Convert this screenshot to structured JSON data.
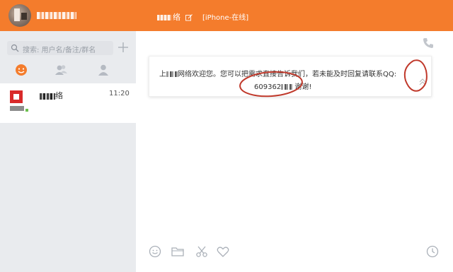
{
  "left_header": {
    "user_name": "-~~ ~~ ~~"
  },
  "search": {
    "placeholder": "搜索: 用户名/备注/群名"
  },
  "tabs": [
    {
      "icon": "smiley-icon",
      "active": true
    },
    {
      "icon": "contacts-icon",
      "active": false
    },
    {
      "icon": "person-icon",
      "active": false
    }
  ],
  "contacts": [
    {
      "name_suffix": "络",
      "time": "11:20"
    }
  ],
  "chat": {
    "title_suffix": "络",
    "status": "[iPhone-在线]",
    "message": {
      "line1_a": "上",
      "line1_b": "网络欢迎您。您可以把需求直接告诉我们，若未能及时回复请联系QQ:",
      "line2_a": "609362",
      "line2_b": "谢谢!"
    }
  },
  "colors": {
    "header_orange": "#f47c2c",
    "sidebar_bg": "#e9ebee",
    "annotation_red": "#c0392b"
  }
}
